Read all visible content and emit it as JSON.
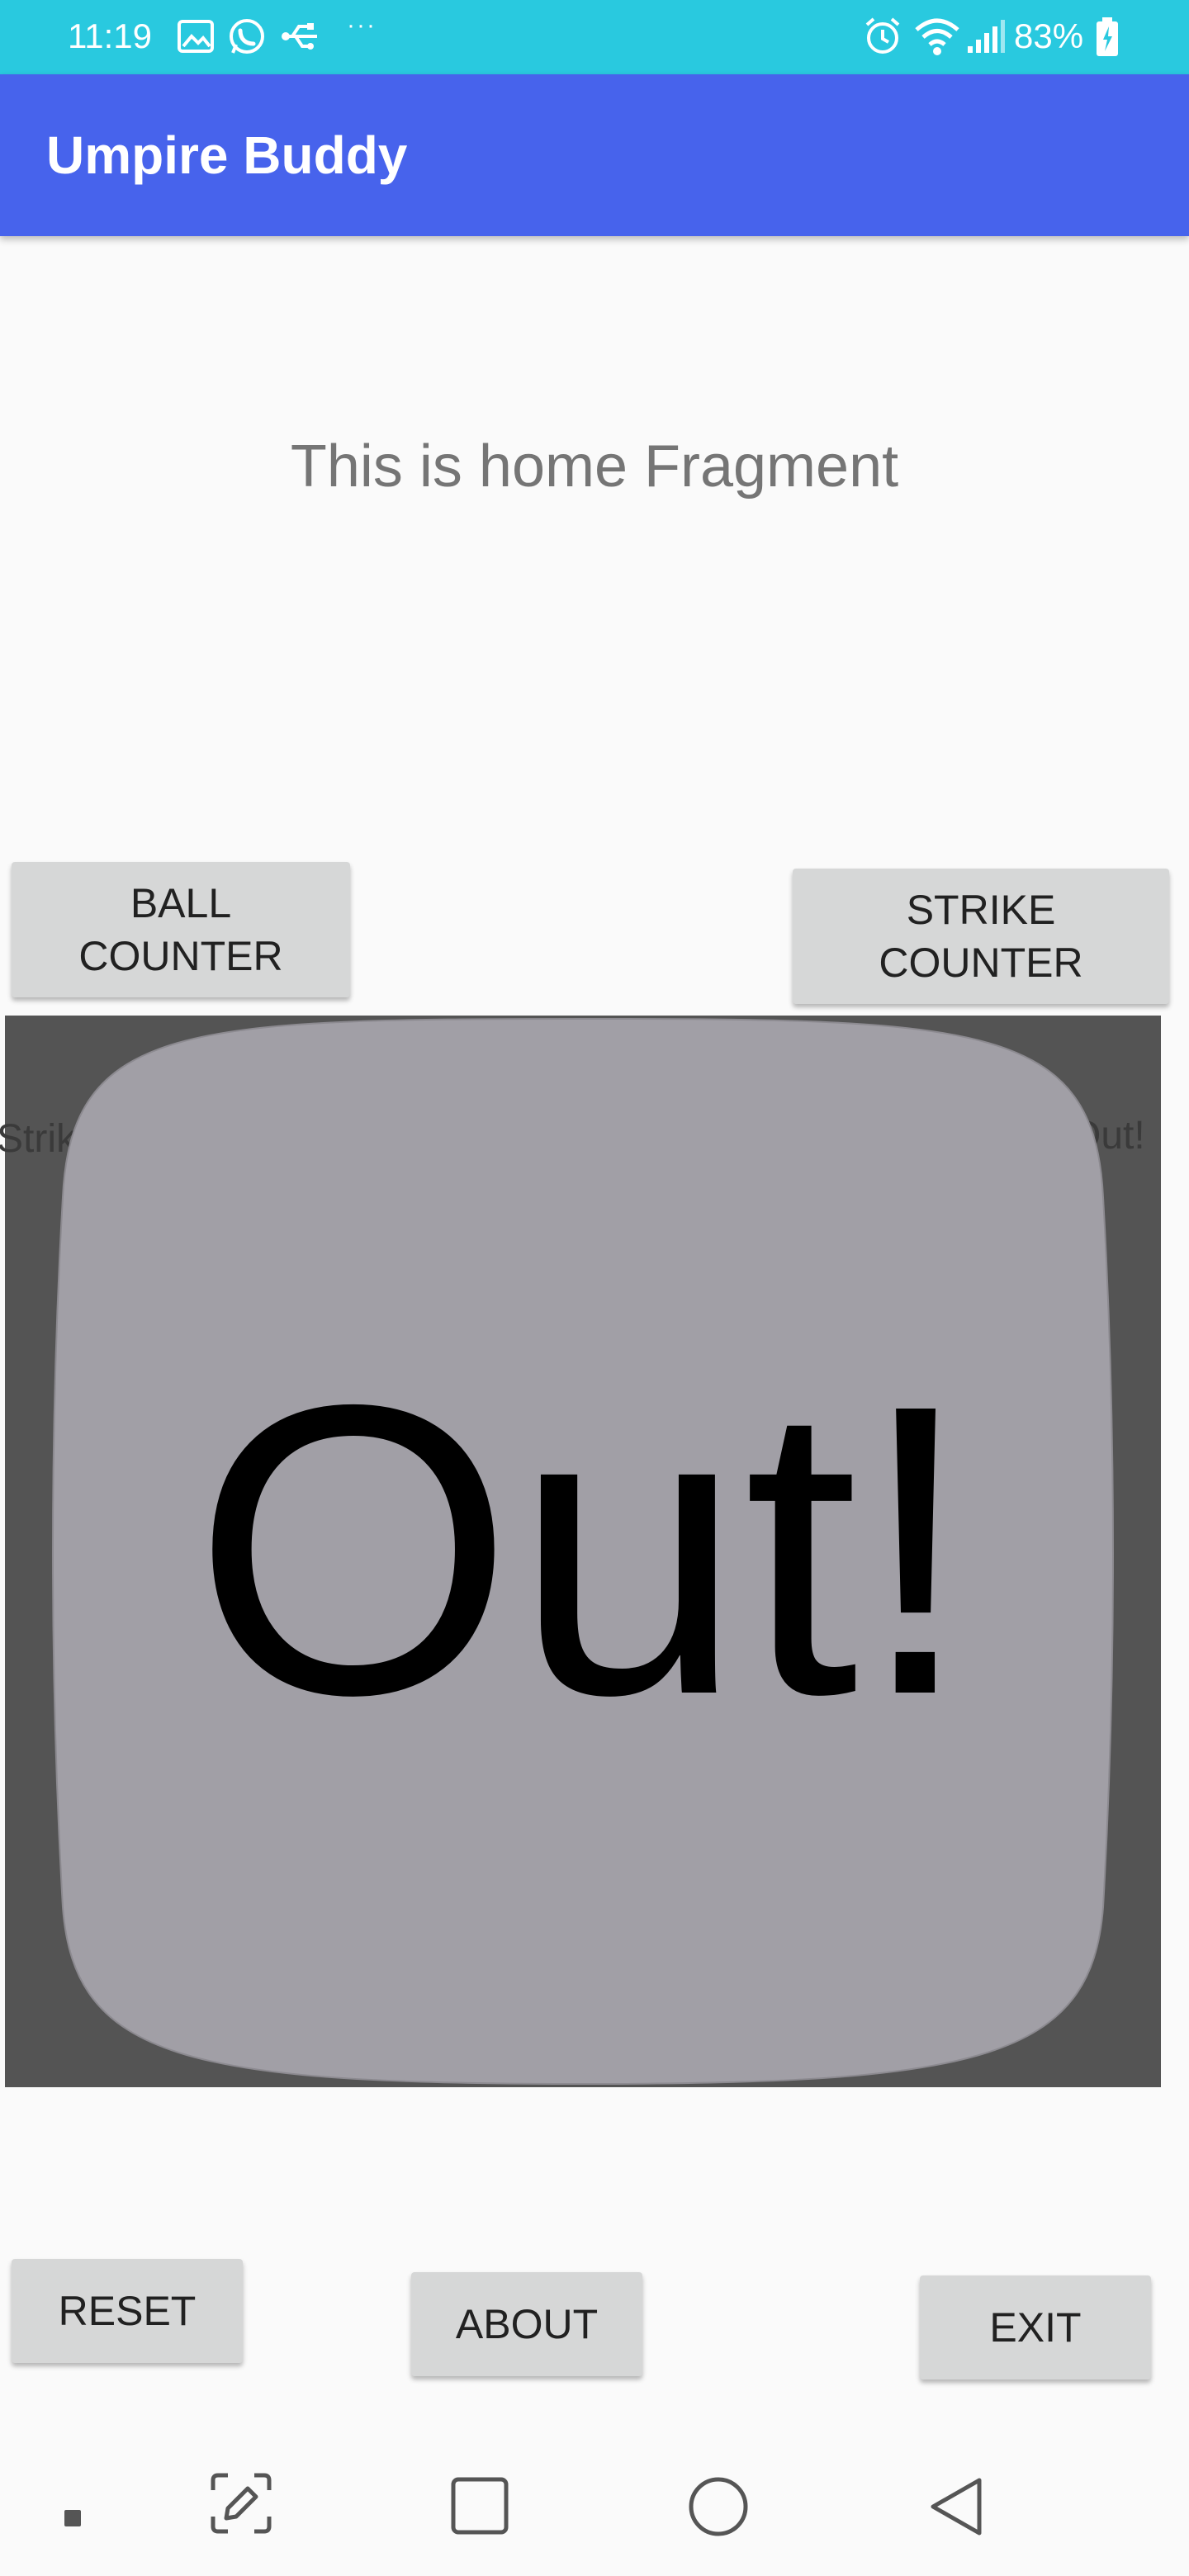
{
  "status_bar": {
    "time": "11:19",
    "battery": "83%",
    "overflow_dots": "···",
    "icons": [
      "gallery-icon",
      "whatsapp-icon",
      "usb-icon",
      "alarm-icon",
      "wifi-icon",
      "signal-icon",
      "battery-icon"
    ]
  },
  "app_bar": {
    "title": "Umpire Buddy"
  },
  "main": {
    "fragment_text": "This is home Fragment",
    "ball_counter_label": "BALL\nCOUNTER",
    "ball_counter_line1": "BALL",
    "ball_counter_line2": "COUNTER",
    "strike_counter_line1": "STRIKE",
    "strike_counter_line2": "COUNTER",
    "faint_left_label": "Strike",
    "faint_right_label": "Out!",
    "image_text": "Out!",
    "reset_label": "RESET",
    "about_label": "ABOUT",
    "exit_label": "EXIT"
  },
  "nav_bar": {
    "icons": [
      "small-square-icon",
      "screenshot-edit-icon",
      "recents-icon",
      "home-icon",
      "back-icon"
    ]
  },
  "colors": {
    "status_bar": "#29c9df",
    "app_bar": "#4763ec",
    "button_bg": "#d6d7d7",
    "image_bg": "#545454",
    "shape_fill": "#a19fa6"
  }
}
